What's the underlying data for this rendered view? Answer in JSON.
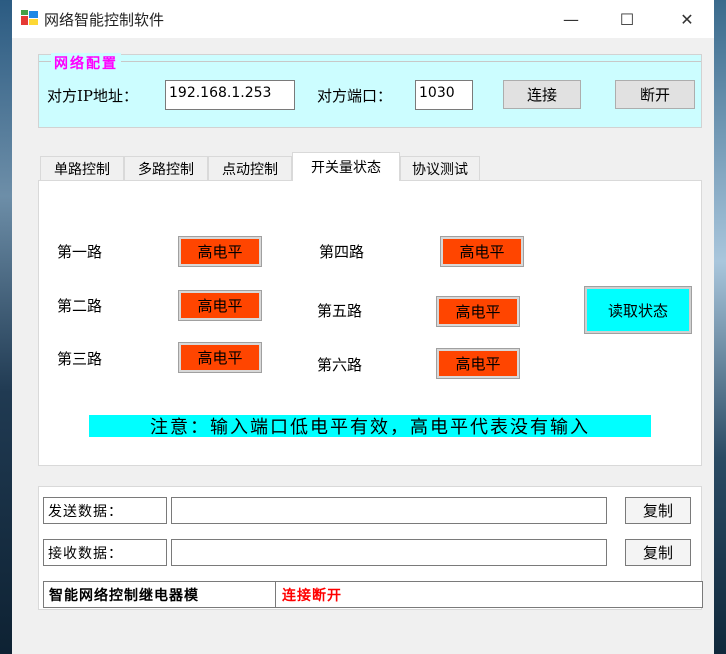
{
  "window": {
    "title": "网络智能控制软件",
    "minimize_glyph": "—",
    "maximize_glyph": "☐",
    "close_glyph": "✕"
  },
  "network_config": {
    "title": "网络配置",
    "ip_label": "对方IP地址：",
    "ip_value": "192.168.1.253",
    "port_label": "对方端口：",
    "port_value": "1030",
    "connect_label": "连接",
    "disconnect_label": "断开"
  },
  "tabs": [
    {
      "label": "单路控制",
      "active": false
    },
    {
      "label": "多路控制",
      "active": false
    },
    {
      "label": "点动控制",
      "active": false
    },
    {
      "label": "开关量状态",
      "active": true
    },
    {
      "label": "协议测试",
      "active": false
    }
  ],
  "switch_status": {
    "routes": [
      {
        "label": "第一路",
        "state": "高电平"
      },
      {
        "label": "第二路",
        "state": "高电平"
      },
      {
        "label": "第三路",
        "state": "高电平"
      },
      {
        "label": "第四路",
        "state": "高电平"
      },
      {
        "label": "第五路",
        "state": "高电平"
      },
      {
        "label": "第六路",
        "state": "高电平"
      }
    ],
    "read_button": "读取状态",
    "notice": "注意：输入端口低电平有效，高电平代表没有输入",
    "level_color": "#ff4500",
    "notice_color": "#00ffff"
  },
  "data_panel": {
    "send_label": "发送数据：",
    "send_value": "",
    "receive_label": "接收数据：",
    "receive_value": "",
    "copy_label": "复制",
    "device_name": "智能网络控制继电器模",
    "connection_status": "连接断开",
    "status_color": "#ff0000"
  },
  "icons": {
    "app": "app-window-icon"
  }
}
